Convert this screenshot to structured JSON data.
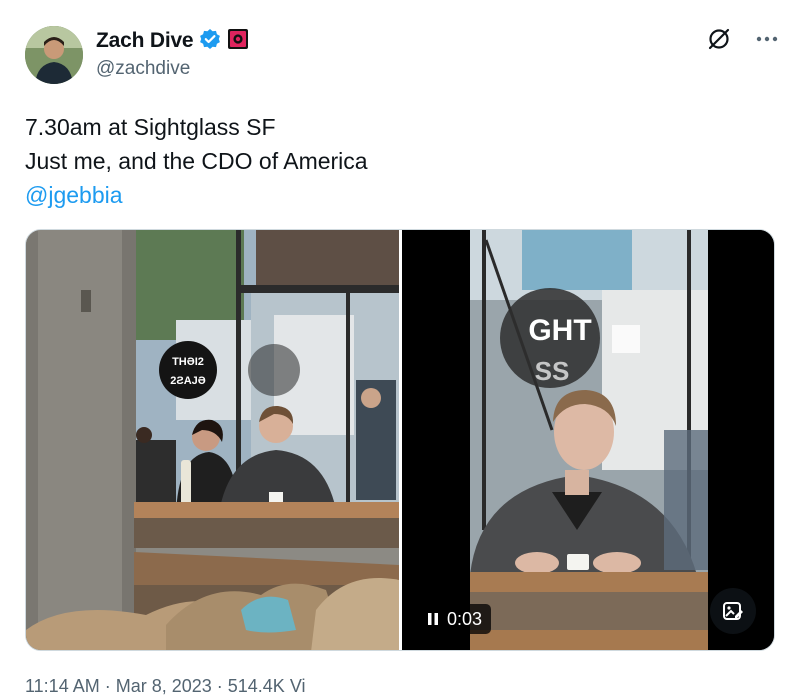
{
  "author": {
    "name": "Zach Dive",
    "handle": "@zachdive"
  },
  "tweet": {
    "line1": "7.30am at Sightglass SF",
    "line2": "Just me, and the CDO of America",
    "mention": "@jgebbia"
  },
  "media": {
    "photo_sign_top": "THƏI2",
    "photo_sign_bottom": "2ƧAJƏ",
    "video_sign_top": "GHT",
    "video_sign_bottom": "SS",
    "video_time": "0:03"
  },
  "footer": {
    "partial_text": "11:14 AM · Mar 8, 2023 · 514.4K Vi"
  },
  "colors": {
    "accent": "#1d9bf0",
    "text": "#0f1419",
    "muted": "#536471",
    "verified": "#1d9bf0",
    "badge": "#e0245e"
  }
}
